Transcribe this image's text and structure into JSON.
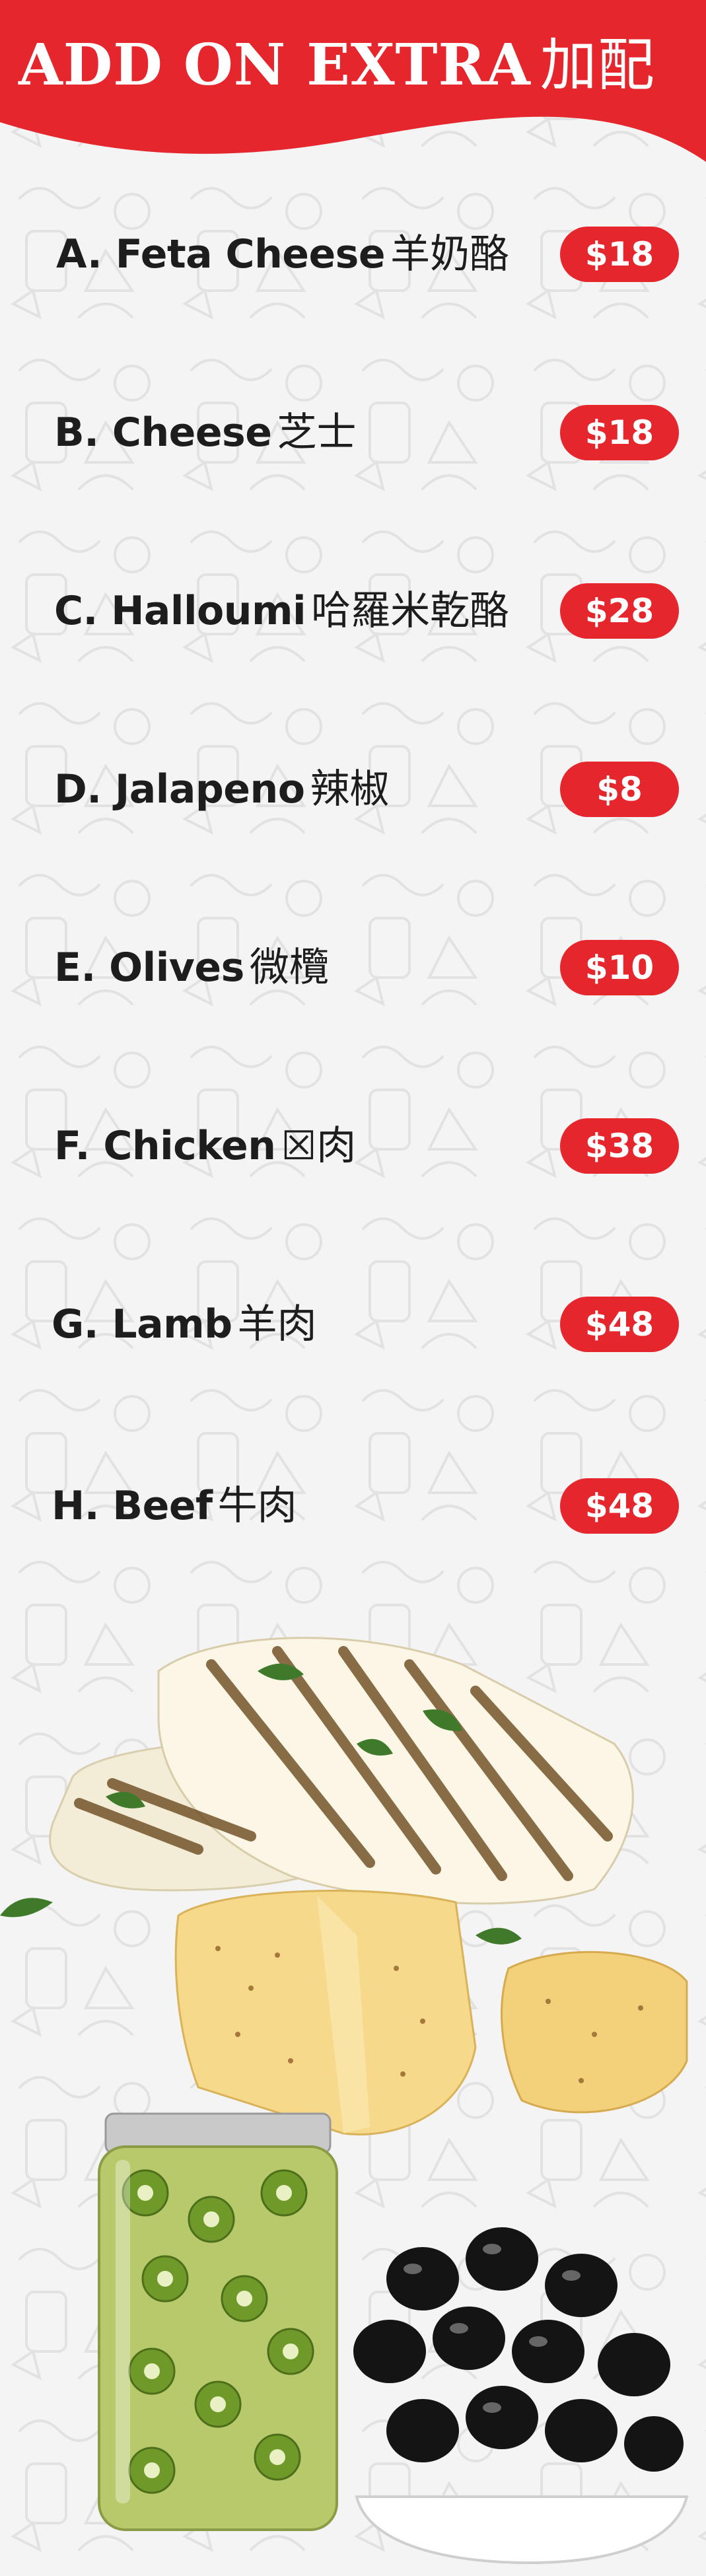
{
  "header": {
    "title_en": "ADD ON EXTRA",
    "title_zh": "加配",
    "background_color": "#e6262d"
  },
  "items": [
    {
      "name": "A. Feta Cheese",
      "name_zh": "羊奶酪",
      "price": "$18"
    },
    {
      "name": "B. Cheese",
      "name_zh": "芝士",
      "price": "$18"
    },
    {
      "name": "C. Halloumi",
      "name_zh": "哈羅米乾酪",
      "price": "$28"
    },
    {
      "name": "D. Jalapeno",
      "name_zh": "辣椒",
      "price": "$8"
    },
    {
      "name": "E. Olives",
      "name_zh": "微欖",
      "price": "$10"
    },
    {
      "name": "F. Chicken",
      "name_zh": "☒肉",
      "price": "$38"
    },
    {
      "name": "G. Lamb",
      "name_zh": "羊肉",
      "price": "$48"
    },
    {
      "name": "H. Beef",
      "name_zh": "牛肉",
      "price": "$48"
    }
  ],
  "colors": {
    "accent": "#e6262d",
    "text": "#1d1d1d",
    "background": "#f4f4f4"
  },
  "images": {
    "halloumi": "grilled-halloumi-illustration",
    "cheese": "cheese-wedge-illustration",
    "jalapeno": "jalapeno-jar-illustration",
    "olives": "black-olives-bowl-illustration"
  }
}
